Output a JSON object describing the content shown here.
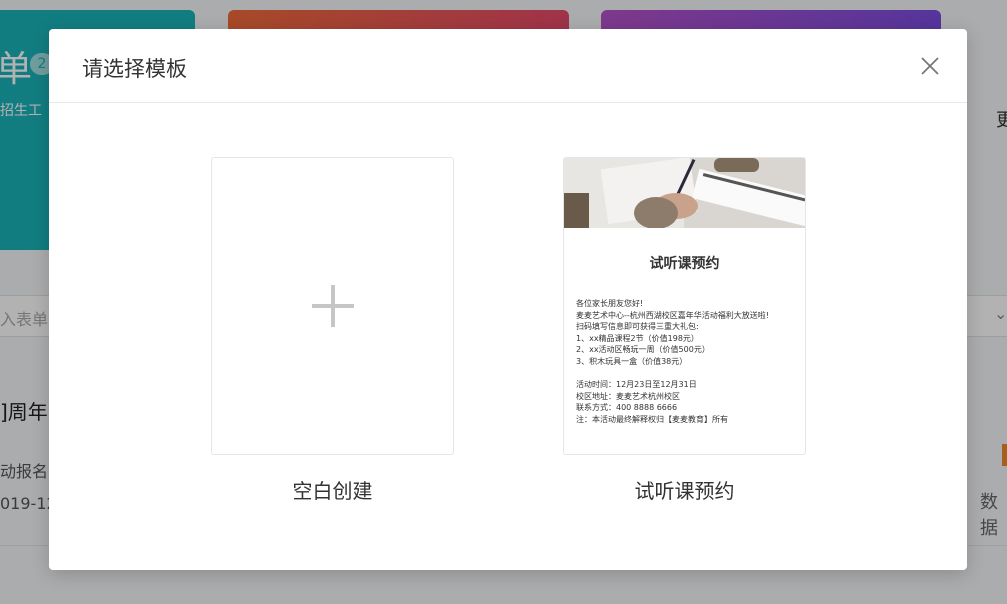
{
  "background": {
    "card_char": "单",
    "card_badge": "2",
    "card_subtitle": "招生工",
    "search_placeholder": "入表单",
    "row_title": "]周年",
    "row_subtitle": "动报名",
    "row_date": "019-12",
    "right_text_top": "更",
    "right_text_bottom": "数据"
  },
  "modal": {
    "title": "请选择模板",
    "close_icon": "close-icon",
    "templates": [
      {
        "caption": "空白创建",
        "icon": "plus-icon"
      },
      {
        "caption": "试听课预约",
        "preview": {
          "title": "试听课预约",
          "lines": [
            "各位家长朋友您好!",
            "麦麦艺术中心--杭州西湖校区嘉年华活动福利大放送啦!",
            "扫码填写信息即可获得三重大礼包:",
            "1、xx精品课程2节（价值198元）",
            "2、xx活动区畅玩一周（价值500元）",
            "3、积木玩具一盒（价值38元）",
            "",
            "活动时间：12月23日至12月31日",
            "校区地址：麦麦艺术杭州校区",
            "联系方式：400 8888 6666",
            "注：本活动最终解释权归【麦麦教育】所有"
          ]
        }
      }
    ]
  },
  "colors": {
    "teal_card": "#1ab3b9",
    "orange_card": "#f06a3a",
    "purple_card": "#b552c9",
    "overlay": "rgba(0,0,0,0.30)"
  }
}
